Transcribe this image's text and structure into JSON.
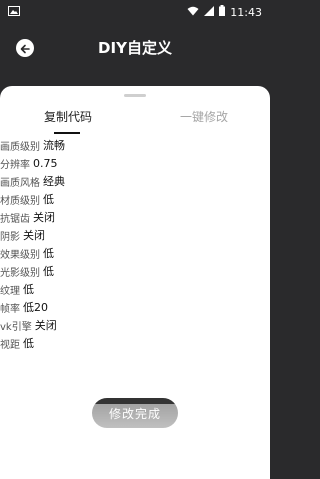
{
  "status_bar": {
    "left_icon": "image-icon",
    "time": "11:43",
    "icons": [
      "wifi-icon",
      "signal-icon",
      "battery-icon"
    ]
  },
  "app_bar": {
    "back_icon": "back-arrow-icon",
    "title": "DIY自定义"
  },
  "sheet": {
    "tabs": [
      {
        "label": "复制代码",
        "active": true
      },
      {
        "label": "一键修改",
        "active": false
      }
    ],
    "rows": [
      {
        "key": "画质级别",
        "value": "流畅"
      },
      {
        "key": "分辨率",
        "value": "0.75"
      },
      {
        "key": "画质风格",
        "value": "经典"
      },
      {
        "key": "材质级别",
        "value": "低"
      },
      {
        "key": "抗锯齿",
        "value": "关闭"
      },
      {
        "key": "阴影",
        "value": "关闭"
      },
      {
        "key": "效果级别",
        "value": "低"
      },
      {
        "key": "光影级别",
        "value": "低"
      },
      {
        "key": "纹理",
        "value": "低"
      },
      {
        "key": "帧率",
        "value": "低20"
      },
      {
        "key": "vk引擎",
        "value": "关闭"
      },
      {
        "key": "视距",
        "value": "低"
      }
    ],
    "confirm_button": "修改完成"
  },
  "colors": {
    "background": "#2a2a2c",
    "sheet": "#ffffff",
    "button": "#333333",
    "inactive_tab": "#a6a6a6"
  }
}
